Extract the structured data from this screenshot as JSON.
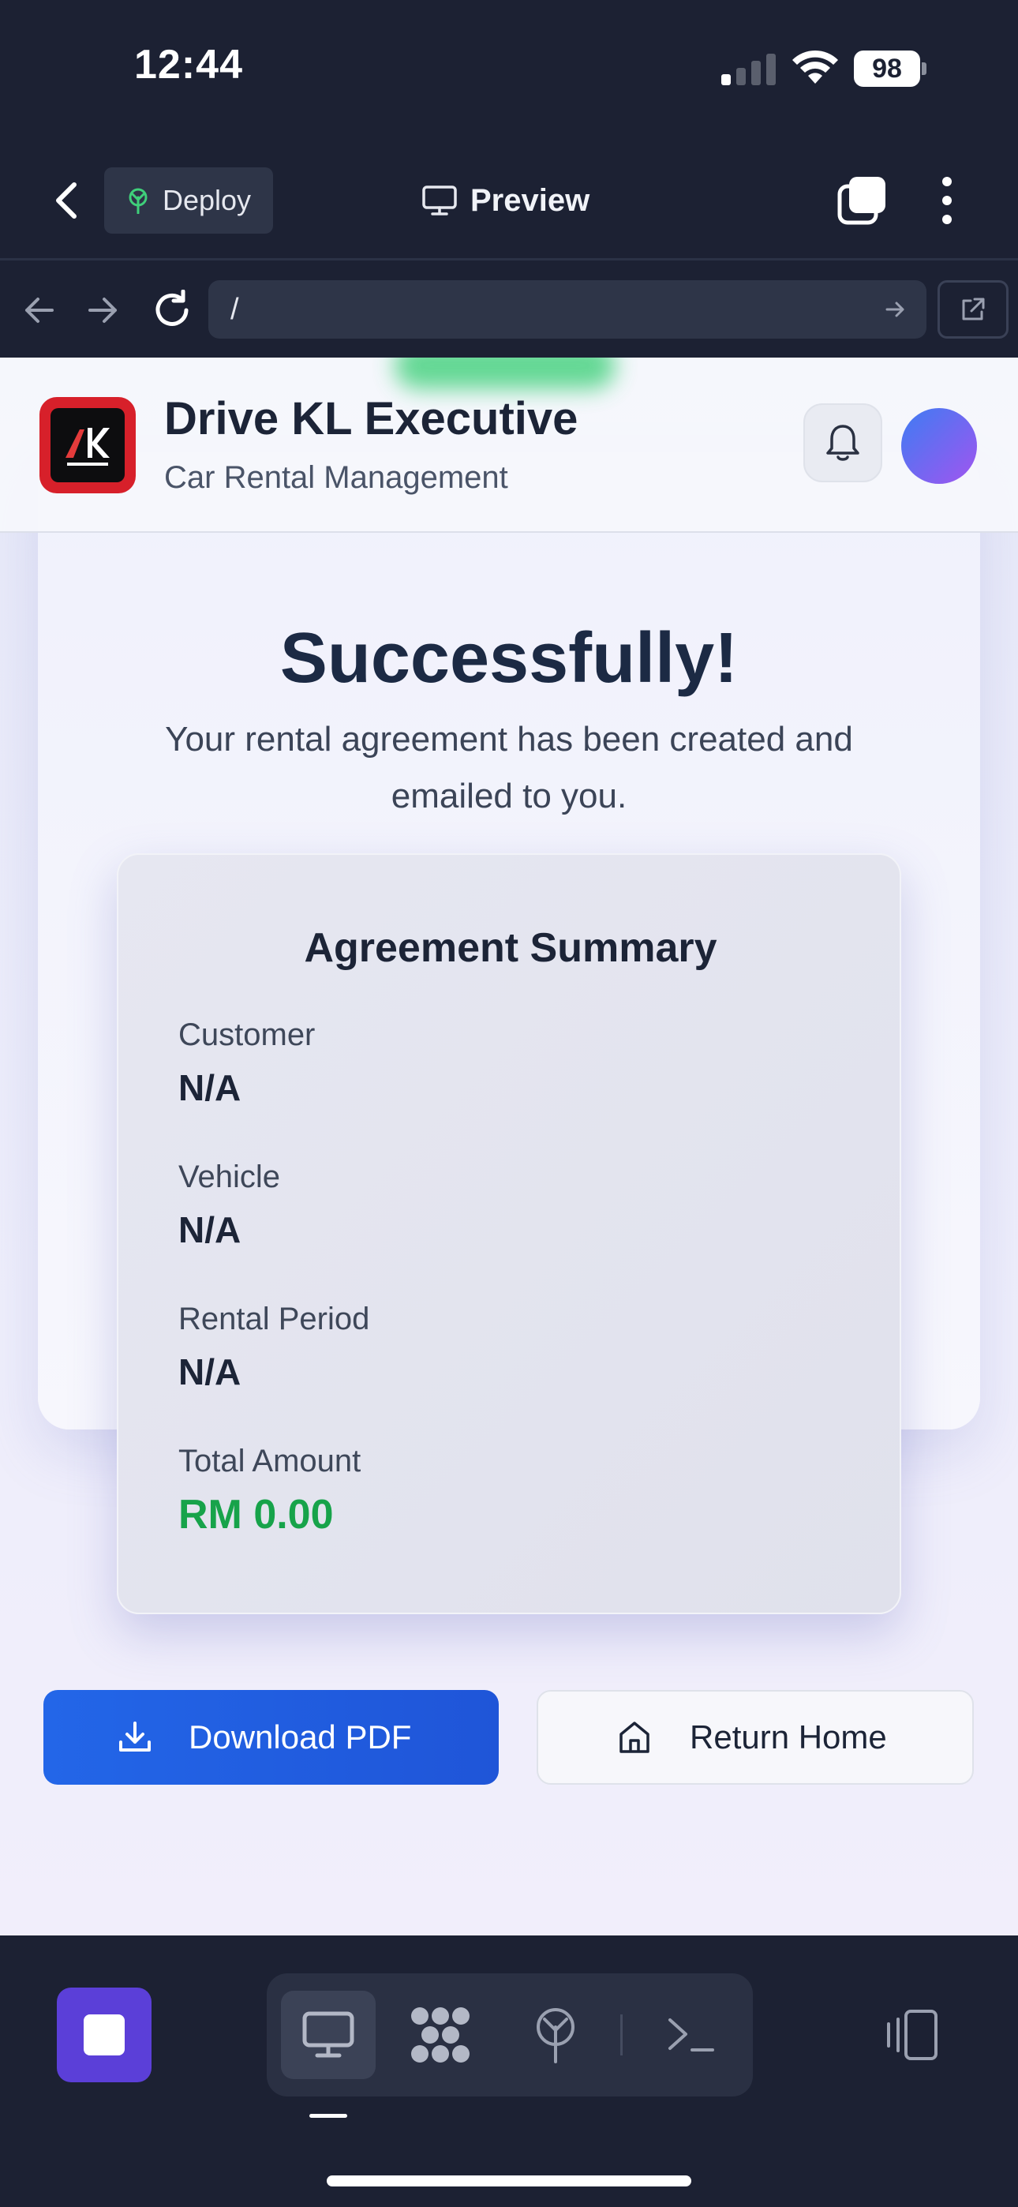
{
  "status_bar": {
    "time": "12:44",
    "battery": "98"
  },
  "toolbar": {
    "deploy_label": "Deploy",
    "preview_label": "Preview"
  },
  "browser": {
    "url": "/"
  },
  "site_header": {
    "title": "Drive KL Executive",
    "subtitle": "Car Rental Management"
  },
  "success": {
    "heading": "Successfully!",
    "message": "Your rental agreement has been created and emailed to you."
  },
  "summary": {
    "title": "Agreement Summary",
    "fields": [
      {
        "label": "Customer",
        "value": "N/A"
      },
      {
        "label": "Vehicle",
        "value": "N/A"
      },
      {
        "label": "Rental Period",
        "value": "N/A"
      },
      {
        "label": "Total Amount",
        "value": "RM 0.00"
      }
    ]
  },
  "actions": {
    "download_label": "Download PDF",
    "home_label": "Return Home"
  },
  "colors": {
    "primary": "#1f55d8",
    "success_green": "#17a34a",
    "app_chrome": "#1c2133",
    "stop_purple": "#5b3fd8"
  },
  "icons": [
    "back-chevron-icon",
    "sprout-icon",
    "monitor-icon",
    "tabs-icon",
    "more-vertical-icon",
    "arrow-left-icon",
    "arrow-right-icon",
    "reload-icon",
    "external-link-icon",
    "bell-icon",
    "download-icon",
    "home-icon",
    "stop-icon",
    "apps-grid-icon",
    "deploy-icon",
    "terminal-icon",
    "device-rotate-icon"
  ]
}
